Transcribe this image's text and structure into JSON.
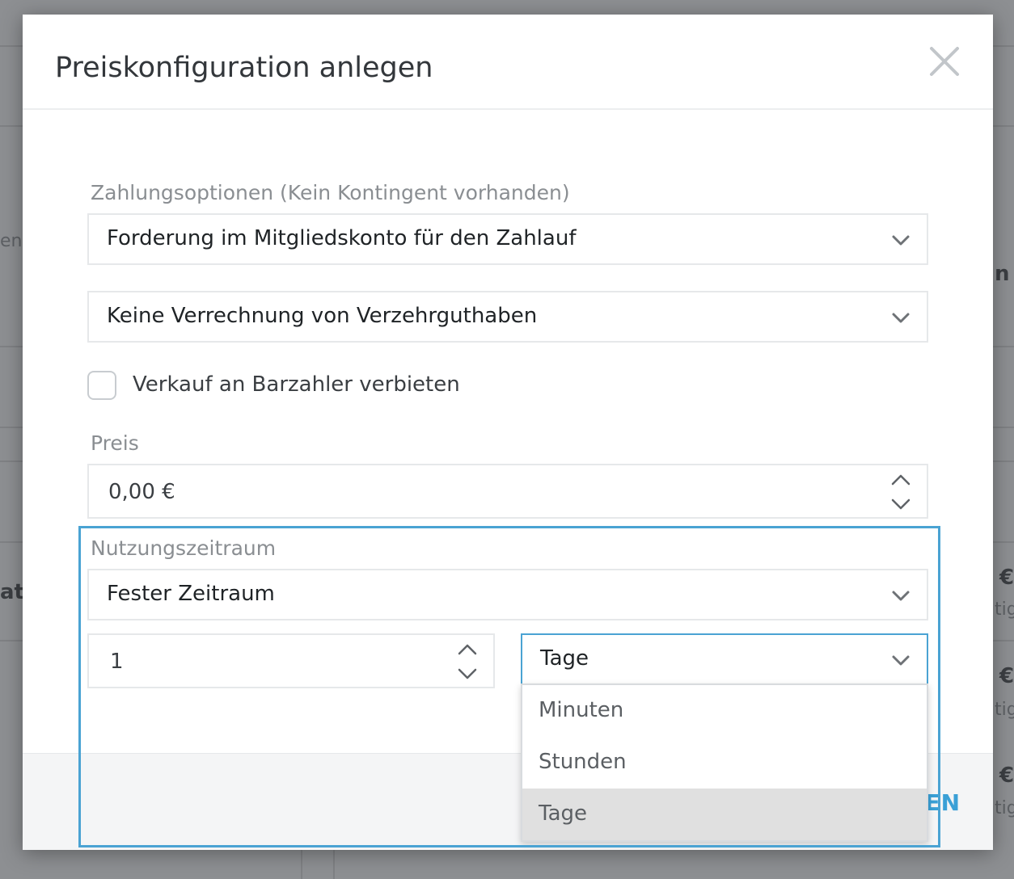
{
  "background": {
    "fragments": [
      "en",
      "n",
      "at",
      "€",
      "tig",
      "€",
      "tig",
      "€",
      "tig"
    ]
  },
  "modal": {
    "title": "Preiskonfiguration anlegen",
    "close_icon": "close-icon"
  },
  "payment": {
    "label": "Zahlungsoptionen (Kein Kontingent vorhanden)",
    "option_value": "Forderung im Mitgliedskonto für den Zahlauf",
    "credit_value": "Keine Verrechnung von Verzehrguthaben"
  },
  "cash": {
    "label": "Verkauf an Barzahler verbieten",
    "checked": false
  },
  "price": {
    "label": "Preis",
    "value": "0,00 €"
  },
  "usage": {
    "label": "Nutzungszeitraum",
    "type_value": "Fester Zeitraum",
    "amount_value": "1",
    "unit_value": "Tage",
    "unit_options": [
      "Minuten",
      "Stunden",
      "Tage"
    ],
    "selected_option": "Tage"
  },
  "footer": {
    "button_label": "EN"
  },
  "colors": {
    "accent": "#4aa3d3",
    "footer_button": "#3aa0d6"
  }
}
